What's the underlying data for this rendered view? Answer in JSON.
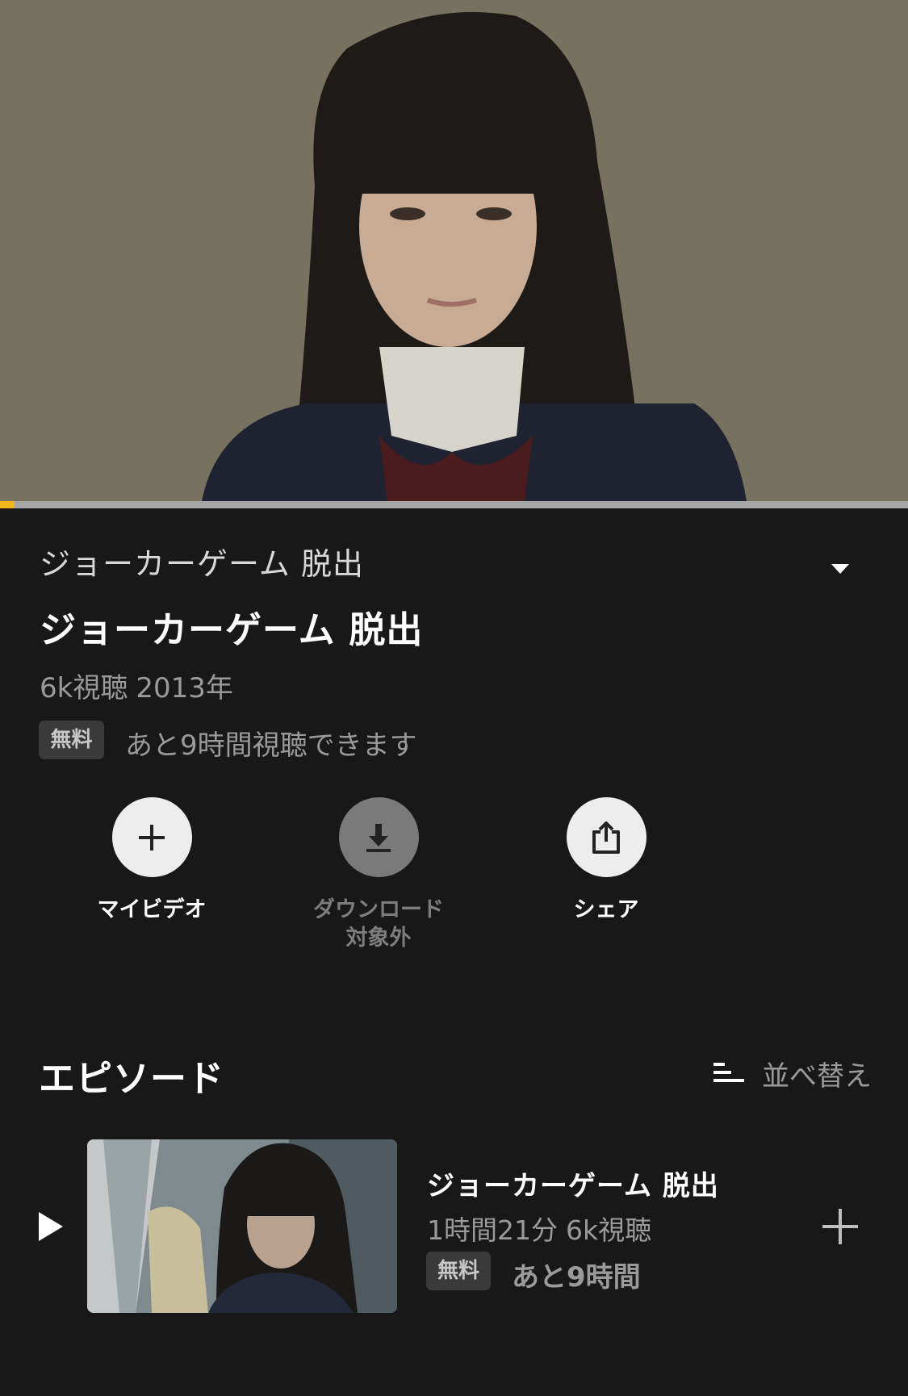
{
  "hero": {
    "image": "drama-still-schoolgirl",
    "progress_percent": 1.6
  },
  "program": {
    "series_title": "ジョーカーゲーム 脱出",
    "title": "ジョーカーゲーム 脱出",
    "views": "6k視聴",
    "year": "2013年",
    "badge": "無料",
    "availability": "あと9時間視聴できます"
  },
  "actions": {
    "my_video": "マイビデオ",
    "download": "ダウンロード\n対象外",
    "share": "シェア"
  },
  "episodes": {
    "section_title": "エピソード",
    "sort_label": "並べ替え",
    "items": [
      {
        "title": "ジョーカーゲーム 脱出",
        "duration": "1時間21分",
        "views": "6k視聴",
        "badge": "無料",
        "remaining": "あと9時間"
      }
    ]
  },
  "icons": {
    "collapse": "caret-down-icon",
    "add": "plus-icon",
    "download": "download-icon",
    "share": "share-icon",
    "sort": "sort-lines-icon",
    "play": "play-icon"
  },
  "colors": {
    "background": "#181818",
    "accent_progress": "#f3b61f",
    "secondary_text": "#9a9a9a"
  }
}
